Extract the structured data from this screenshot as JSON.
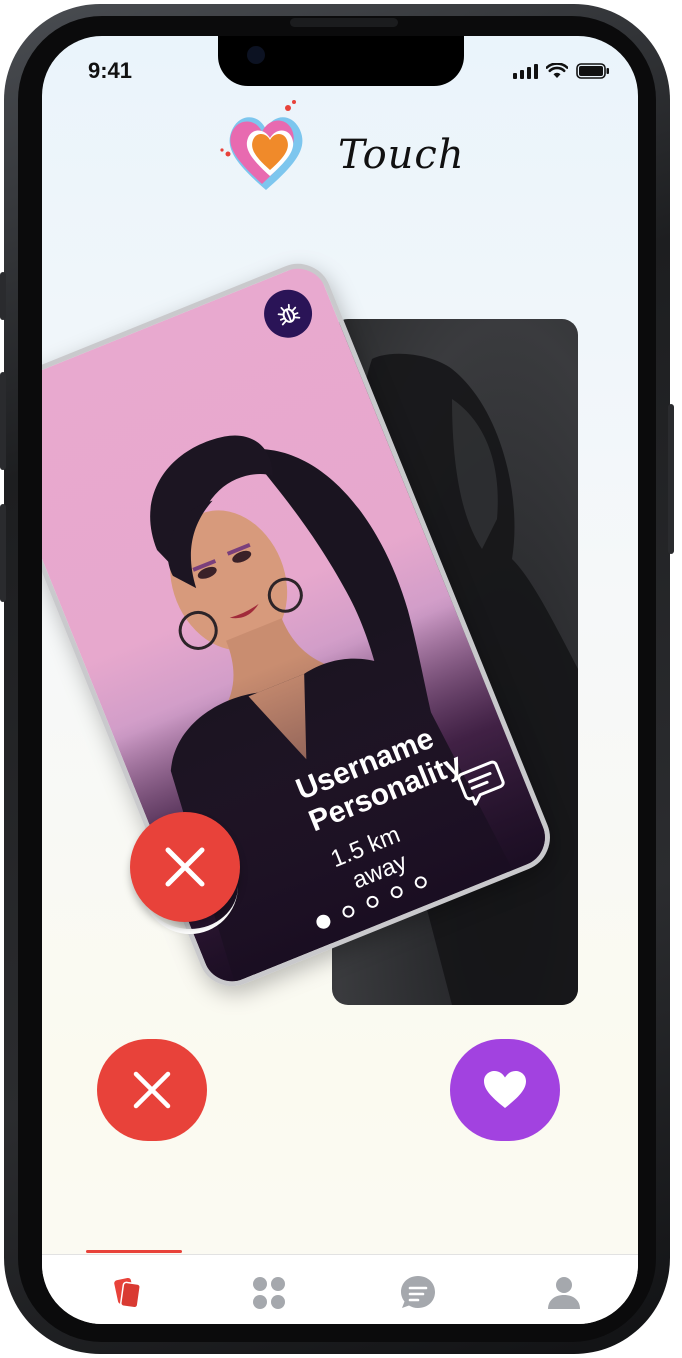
{
  "status_bar": {
    "time": "9:41"
  },
  "app": {
    "brand_name": "Touch"
  },
  "profile_card": {
    "username": "Username",
    "personality": "Personality",
    "distance": "1.5 km",
    "distance_suffix": "away",
    "photo_count": 5,
    "active_photo_index": 0
  },
  "colors": {
    "reject": "#e8423a",
    "like": "#a242e0",
    "bug_badge": "#2a1457",
    "tab_active": "#e8423a",
    "tab_inactive": "#a5a8ad"
  },
  "icons": {
    "bug_button": "bug-icon",
    "chat_button": "chat-icon",
    "reject_button": "close-icon",
    "like_button": "heart-icon"
  },
  "tabs": [
    {
      "name": "cards",
      "icon": "cards-icon",
      "active": true
    },
    {
      "name": "explore",
      "icon": "grid-icon",
      "active": false
    },
    {
      "name": "messages",
      "icon": "chat-icon",
      "active": false
    },
    {
      "name": "profile",
      "icon": "user-icon",
      "active": false
    }
  ]
}
